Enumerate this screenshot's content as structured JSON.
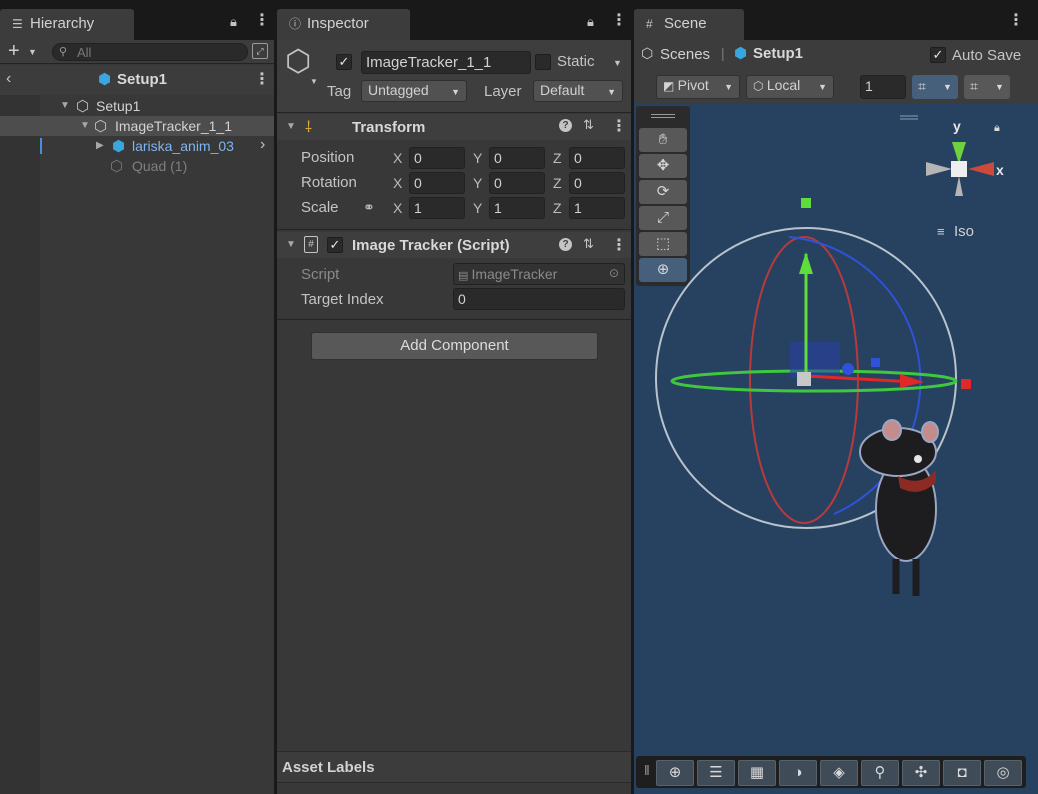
{
  "hierarchy": {
    "tab_label": "Hierarchy",
    "search_placeholder": "All",
    "scene_title": "Setup1",
    "tree": [
      {
        "label": "Setup1"
      },
      {
        "label": "ImageTracker_1_1"
      },
      {
        "label": "lariska_anim_03"
      },
      {
        "label": "Quad (1)"
      }
    ]
  },
  "inspector": {
    "tab_label": "Inspector",
    "object_name": "ImageTracker_1_1",
    "static_label": "Static",
    "tag_label": "Tag",
    "tag_value": "Untagged",
    "layer_label": "Layer",
    "layer_value": "Default",
    "transform": {
      "title": "Transform",
      "rows": [
        {
          "label": "Position",
          "x": "0",
          "y": "0",
          "z": "0"
        },
        {
          "label": "Rotation",
          "x": "0",
          "y": "0",
          "z": "0"
        },
        {
          "label": "Scale",
          "x": "1",
          "y": "1",
          "z": "1"
        }
      ],
      "axis_x": "X",
      "axis_y": "Y",
      "axis_z": "Z"
    },
    "script_component": {
      "title": "Image Tracker (Script)",
      "script_label": "Script",
      "script_value": "ImageTracker",
      "target_index_label": "Target Index",
      "target_index_value": "0"
    },
    "add_component_label": "Add Component",
    "asset_labels": "Asset Labels"
  },
  "scene": {
    "tab_label": "Scene",
    "scenes_label": "Scenes",
    "breadcrumb_scene": "Setup1",
    "auto_save_label": "Auto Save",
    "pivot_label": "Pivot",
    "local_label": "Local",
    "grid_value": "1",
    "gizmo_y": "y",
    "gizmo_x": "x",
    "iso_label": "Iso"
  },
  "colors": {
    "accent_blue": "#4c8ed9",
    "scene_bg": "#274160",
    "prefab_blue": "#7fb4ee"
  }
}
